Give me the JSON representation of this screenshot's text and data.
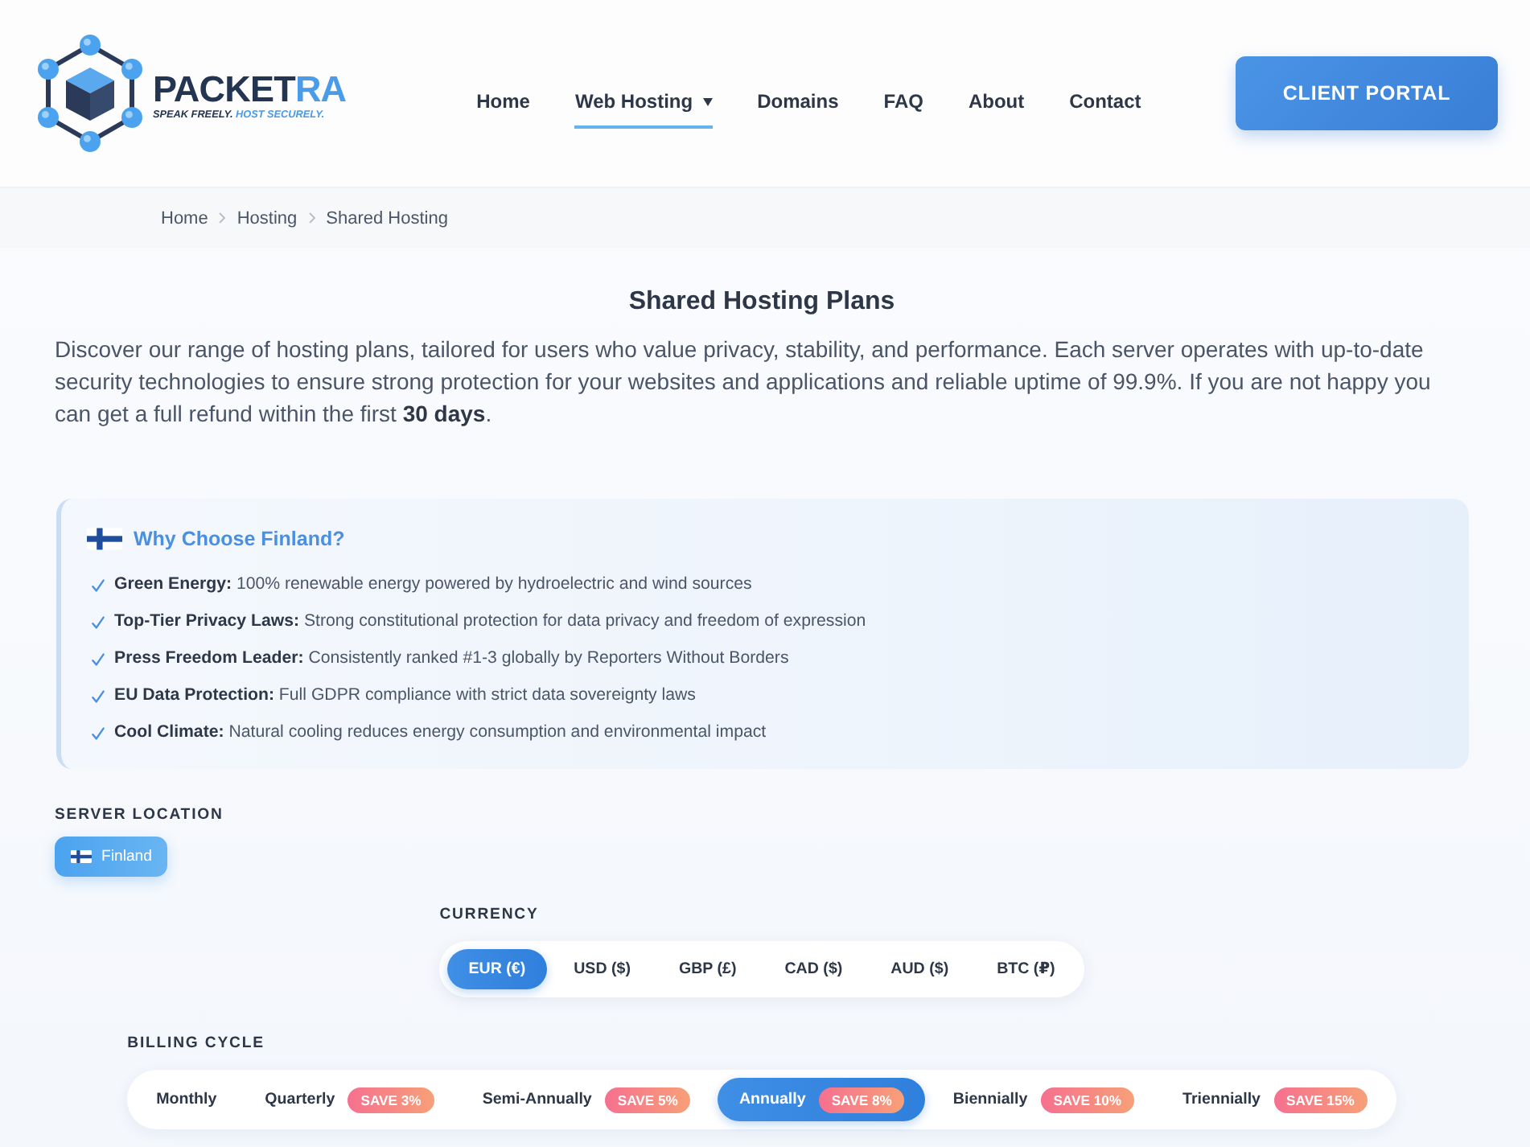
{
  "header": {
    "logo": {
      "wordmark": [
        {
          "text": "PACKET",
          "accent": false
        },
        {
          "text": "RA",
          "accent": true
        }
      ],
      "tagline": [
        {
          "text": "SPEAK FREELY.",
          "accent": false
        },
        {
          "text": "HOST SECURELY.",
          "accent": true
        }
      ]
    },
    "nav": [
      {
        "label": "Home",
        "selected": false,
        "dropdown": false
      },
      {
        "label": "Web Hosting",
        "selected": true,
        "dropdown": true
      },
      {
        "label": "Domains",
        "selected": false,
        "dropdown": false
      },
      {
        "label": "FAQ",
        "selected": false,
        "dropdown": false
      },
      {
        "label": "About",
        "selected": false,
        "dropdown": false
      },
      {
        "label": "Contact",
        "selected": false,
        "dropdown": false
      }
    ],
    "cta": "CLIENT PORTAL"
  },
  "breadcrumb": [
    "Home",
    "Hosting",
    "Shared Hosting"
  ],
  "intro": {
    "title": "Shared Hosting Plans",
    "text": "Discover our range of hosting plans, tailored for users who value privacy, stability, and performance. Each server operates with up-to-date security technologies to ensure strong protection for your websites and applications and reliable uptime of 99.9%. If you are not happy you can get a full refund within the first **30 days**."
  },
  "feature_box": {
    "title": "Why Choose Finland?",
    "items": [
      "**Green Energy:** 100% renewable energy powered by hydroelectric and wind sources",
      "**Top-Tier Privacy Laws:** Strong constitutional protection for data privacy and freedom of expression",
      "**Press Freedom Leader:** Consistently ranked #1-3 globally by Reporters Without Borders",
      "**EU Data Protection:** Full GDPR compliance with strict data sovereignty laws",
      "**Cool Climate:** Natural cooling reduces energy consumption and environmental impact"
    ]
  },
  "location": {
    "label": "SERVER LOCATION",
    "options": [
      {
        "label": "Finland",
        "selected": true
      }
    ]
  },
  "currency": {
    "label": "CURRENCY",
    "options": [
      {
        "label": "EUR (€)",
        "selected": true
      },
      {
        "label": "USD ($)",
        "selected": false
      },
      {
        "label": "GBP (£)",
        "selected": false
      },
      {
        "label": "CAD ($)",
        "selected": false
      },
      {
        "label": "AUD ($)",
        "selected": false
      },
      {
        "label": "BTC (₽)",
        "selected": false
      }
    ]
  },
  "billing": {
    "label": "BILLING CYCLE",
    "options": [
      {
        "label": "Monthly",
        "selected": false
      },
      {
        "label": "Quarterly",
        "badge": "SAVE 3%",
        "selected": false
      },
      {
        "label": "Semi-Annually",
        "badge": "SAVE 5%",
        "selected": false
      },
      {
        "label": "Annually",
        "badge": "SAVE 8%",
        "selected": true
      },
      {
        "label": "Biennially",
        "badge": "SAVE 10%",
        "selected": false
      },
      {
        "label": "Triennially",
        "badge": "SAVE 15%",
        "selected": false
      }
    ]
  }
}
